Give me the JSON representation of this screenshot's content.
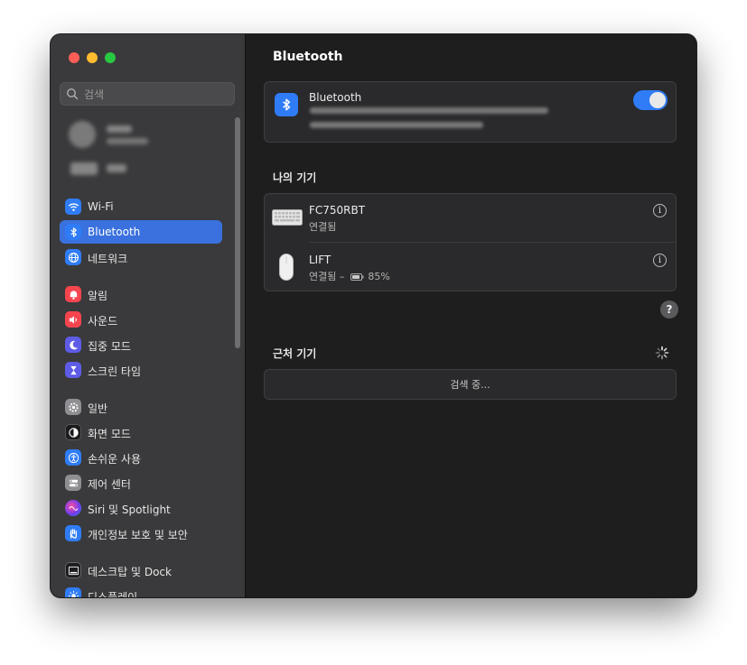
{
  "window": {
    "controls": [
      "close",
      "minimize",
      "zoom"
    ]
  },
  "sidebar": {
    "search": {
      "placeholder": "검색",
      "value": ""
    },
    "items": [
      {
        "label": "Wi-Fi",
        "icon": "wifi-icon",
        "color": "#2f7cf6",
        "active": false
      },
      {
        "label": "Bluetooth",
        "icon": "bluetooth-icon",
        "color": "#2f7cf6",
        "active": true
      },
      {
        "label": "네트워크",
        "icon": "globe-icon",
        "color": "#2f7cf6",
        "active": false
      },
      {
        "label": "알림",
        "icon": "bell-icon",
        "color": "#f5454f",
        "active": false
      },
      {
        "label": "사운드",
        "icon": "speaker-icon",
        "color": "#f5454f",
        "active": false
      },
      {
        "label": "집중 모드",
        "icon": "moon-icon",
        "color": "#5e5ce6",
        "active": false
      },
      {
        "label": "스크린 타임",
        "icon": "hourglass-icon",
        "color": "#5e5ce6",
        "active": false
      },
      {
        "label": "일반",
        "icon": "gear-icon",
        "color": "#8e8e93",
        "active": false
      },
      {
        "label": "화면 모드",
        "icon": "appearance-icon",
        "color": "#1c1c1e",
        "active": false
      },
      {
        "label": "손쉬운 사용",
        "icon": "accessibility-icon",
        "color": "#2f7cf6",
        "active": false
      },
      {
        "label": "제어 센터",
        "icon": "control-center-icon",
        "color": "#8e8e93",
        "active": false
      },
      {
        "label": "Siri 및 Spotlight",
        "icon": "siri-icon",
        "color": "#c13cc9",
        "active": false
      },
      {
        "label": "개인정보 보호 및 보안",
        "icon": "hand-icon",
        "color": "#2f7cf6",
        "active": false
      },
      {
        "label": "데스크탑 및 Dock",
        "icon": "dock-icon",
        "color": "#1c1c1e",
        "active": false
      },
      {
        "label": "디스플레이",
        "icon": "sun-icon",
        "color": "#2f7cf6",
        "active": false
      }
    ]
  },
  "main": {
    "title": "Bluetooth",
    "bluetooth_card": {
      "label": "Bluetooth",
      "toggle_on": true
    },
    "my_devices": {
      "heading": "나의 기기",
      "devices": [
        {
          "name": "FC750RBT",
          "status": "연결됨",
          "icon": "keyboard-icon"
        },
        {
          "name": "LIFT",
          "status": "연결됨 –",
          "battery": "85%",
          "icon": "mouse-icon"
        }
      ]
    },
    "help_label": "?",
    "nearby": {
      "heading": "근처 기기",
      "searching_label": "검색 중..."
    }
  }
}
